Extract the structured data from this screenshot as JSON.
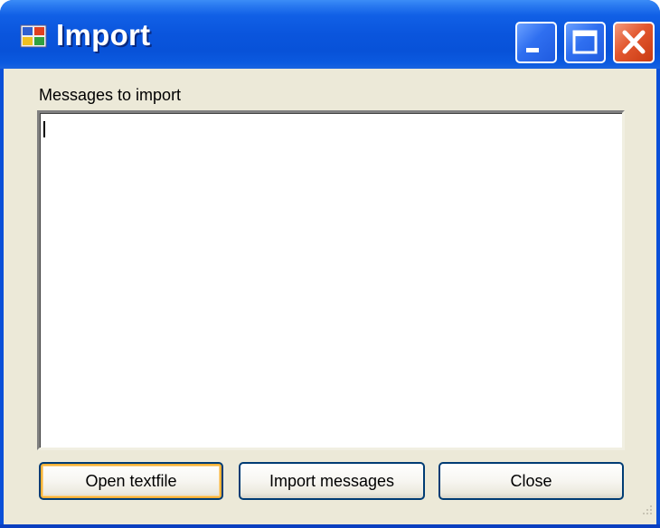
{
  "window": {
    "title": "Import",
    "icon": "app-window-icon",
    "controls": {
      "minimize_icon": "minimize-icon",
      "maximize_icon": "maximize-icon",
      "close_icon": "close-icon"
    }
  },
  "form": {
    "messages_label": "Messages to import",
    "messages_value": ""
  },
  "buttons": {
    "open_textfile": "Open textfile",
    "import_messages": "Import messages",
    "close": "Close"
  },
  "colors": {
    "title_bar": "#0a55dd",
    "client_background": "#ece9d8",
    "close_button": "#e2572e",
    "default_button_highlight": "#f8b339"
  }
}
